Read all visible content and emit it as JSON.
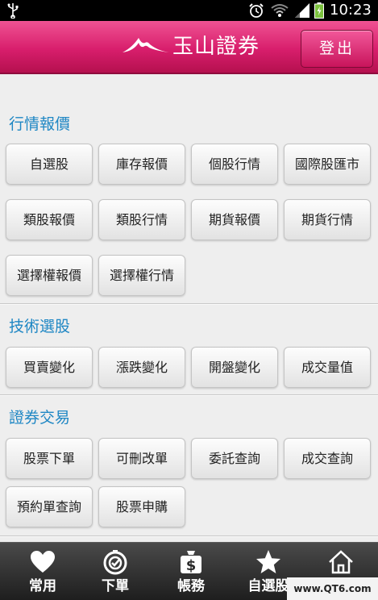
{
  "status_bar": {
    "time": "10:23"
  },
  "header": {
    "brand": "玉山證券",
    "logout_label": "登出"
  },
  "sections": [
    {
      "title": "行情報價",
      "buttons": [
        "自選股",
        "庫存報價",
        "個股行情",
        "國際股匯市",
        "類股報價",
        "類股行情",
        "期貨報價",
        "期貨行情",
        "選擇權報價",
        "選擇權行情"
      ]
    },
    {
      "title": "技術選股",
      "buttons": [
        "買賣變化",
        "漲跌變化",
        "開盤變化",
        "成交量值"
      ]
    },
    {
      "title": "證券交易",
      "buttons": [
        "股票下單",
        "可刪改單",
        "委託查詢",
        "成交查詢",
        "預約單查詢",
        "股票申購"
      ]
    }
  ],
  "tabs": [
    {
      "label": "常用",
      "icon": "heart-icon"
    },
    {
      "label": "下單",
      "icon": "order-icon"
    },
    {
      "label": "帳務",
      "icon": "money-bag-icon"
    },
    {
      "label": "自選股",
      "icon": "star-icon"
    },
    {
      "label": "首頁",
      "icon": "home-icon"
    }
  ],
  "watermark": "www.QT6.com",
  "colors": {
    "accent": "#d81e6c",
    "section_title": "#1f87c4",
    "tabbar": "#2a2a2a"
  }
}
